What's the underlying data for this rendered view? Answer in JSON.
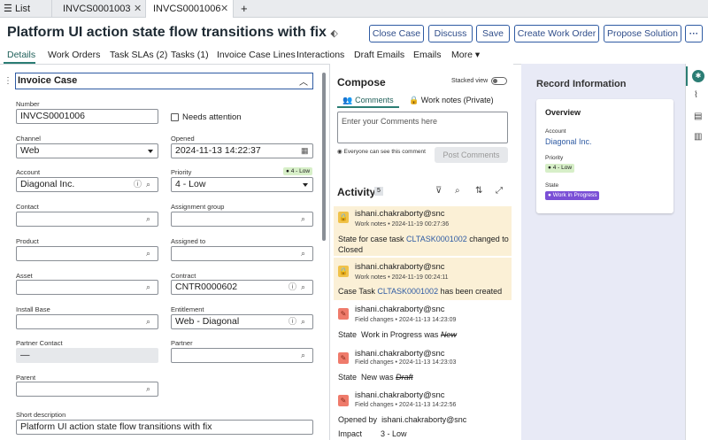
{
  "tabstrip": {
    "list_label": "List",
    "tabs": [
      {
        "label": "INVCS0001003"
      },
      {
        "label": "INVCS0001006"
      }
    ],
    "add_label": "+"
  },
  "header": {
    "title": "Platform UI action state flow transitions with fix",
    "buttons": {
      "close_case": "Close Case",
      "discuss": "Discuss",
      "save": "Save",
      "create_work_order": "Create Work Order",
      "propose_solution": "Propose Solution",
      "more": "···"
    }
  },
  "form_tabs": [
    "Details",
    "Work Orders",
    "Task SLAs (2)",
    "Tasks (1)",
    "Invoice Case Lines",
    "Interactions",
    "Draft Emails",
    "Emails",
    "More"
  ],
  "section_title": "Invoice Case",
  "form": {
    "number": {
      "label": "Number",
      "value": "INVCS0001006"
    },
    "needs_attention": {
      "label": "Needs attention",
      "checked": false
    },
    "channel": {
      "label": "Channel",
      "value": "Web"
    },
    "opened": {
      "label": "Opened",
      "value": "2024-11-13 14:22:37"
    },
    "account": {
      "label": "Account",
      "value": "Diagonal Inc."
    },
    "priority": {
      "label": "Priority",
      "value": "4 - Low",
      "badge": "4 - Low"
    },
    "contact": {
      "label": "Contact",
      "value": ""
    },
    "assignment_group": {
      "label": "Assignment group",
      "value": ""
    },
    "product": {
      "label": "Product",
      "value": ""
    },
    "assigned_to": {
      "label": "Assigned to",
      "value": ""
    },
    "asset": {
      "label": "Asset",
      "value": ""
    },
    "contract": {
      "label": "Contract",
      "value": "CNTR0000602"
    },
    "install_base": {
      "label": "Install Base",
      "value": ""
    },
    "entitlement": {
      "label": "Entitlement",
      "value": "Web - Diagonal"
    },
    "partner_contact": {
      "label": "Partner Contact",
      "value": "—"
    },
    "partner": {
      "label": "Partner",
      "value": ""
    },
    "parent": {
      "label": "Parent",
      "value": ""
    },
    "short_description": {
      "label": "Short description",
      "value": "Platform UI action state flow transitions with fix"
    }
  },
  "compose": {
    "title": "Compose",
    "stacked_view": "Stacked view",
    "tab_comments": "Comments",
    "tab_work_notes": "Work notes (Private)",
    "placeholder": "Enter your Comments here",
    "visibility_note": "Everyone can see this comment",
    "post_button": "Post Comments"
  },
  "activity": {
    "title": "Activity",
    "count": "5",
    "entries": [
      {
        "user": "ishani.chakraborty@snc",
        "meta": "Work notes • 2024-11-19 00:27:36",
        "line1_pre": "State for case task ",
        "link": "CLTASK0001002",
        "line1_post": " changed to",
        "line2": "Closed"
      },
      {
        "user": "ishani.chakraborty@snc",
        "meta": "Work notes • 2024-11-19 00:24:11",
        "line1_pre": "Case Task ",
        "link": "CLTASK0001002",
        "line1_post": " has been created"
      },
      {
        "user": "ishani.chakraborty@snc",
        "meta": "Field changes • 2024-11-13 14:23:09",
        "field": "State",
        "new": "Work in Progress",
        "was": "was",
        "old": "New"
      },
      {
        "user": "ishani.chakraborty@snc",
        "meta": "Field changes • 2024-11-13 14:23:03",
        "field": "State",
        "new": "New",
        "was": "was",
        "old": "Draft"
      },
      {
        "user": "ishani.chakraborty@snc",
        "meta": "Field changes • 2024-11-13 14:22:56",
        "rows": [
          {
            "field": "Opened by",
            "value": "ishani.chakraborty@snc"
          },
          {
            "field": "Impact",
            "value": "3 - Low"
          }
        ]
      }
    ]
  },
  "record_info": {
    "title": "Record Information",
    "card_title": "Overview",
    "account_label": "Account",
    "account_value": "Diagonal Inc.",
    "priority_label": "Priority",
    "priority_value": "4 - Low",
    "state_label": "State",
    "state_value": "Work in Progress"
  },
  "colors": {
    "accent": "#2f5ba3",
    "teal": "#2b7d74",
    "worknote_bg": "#fbf0d6",
    "state_badge": "#7a4fd6",
    "priority_badge": "#d7efc8"
  }
}
